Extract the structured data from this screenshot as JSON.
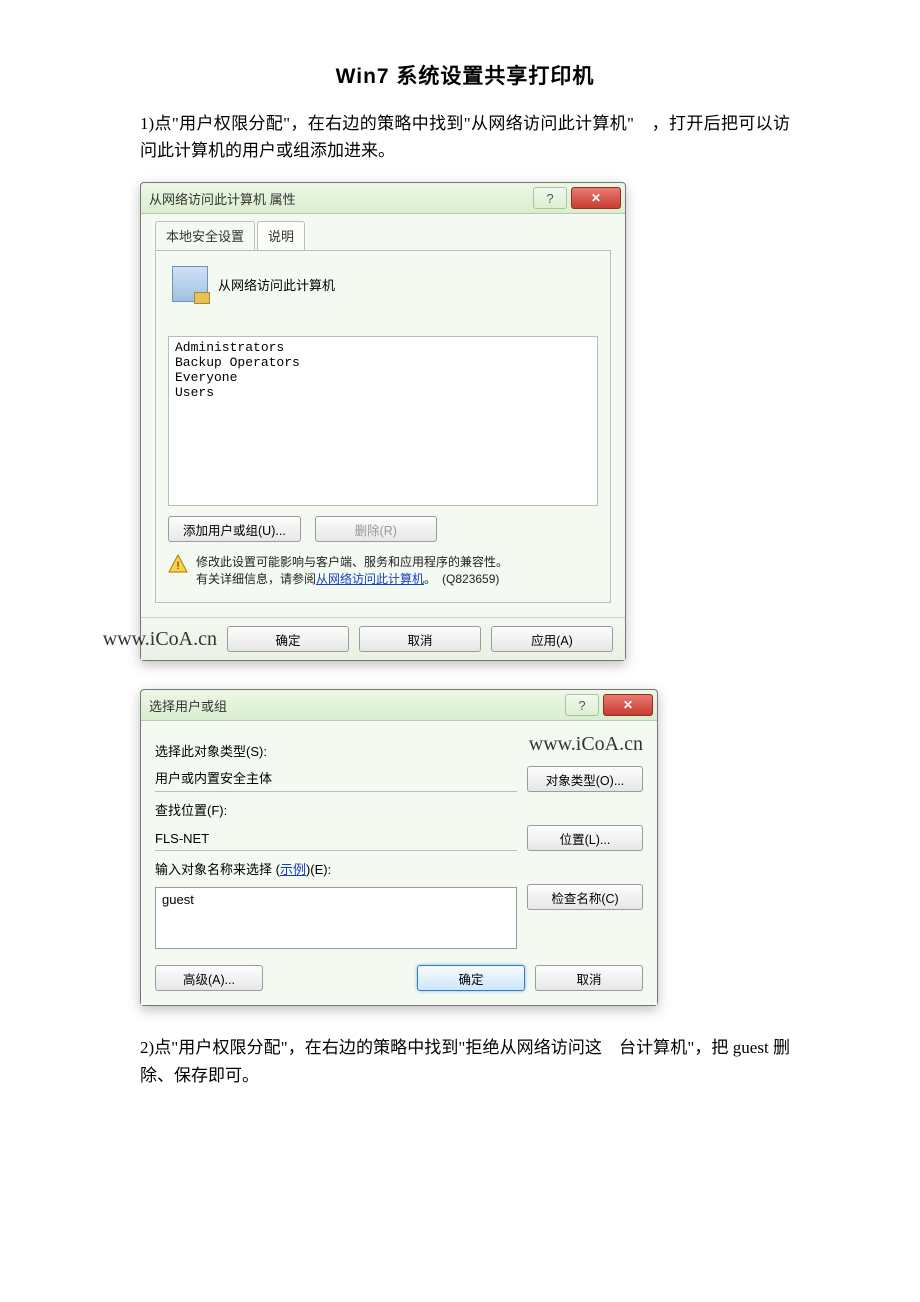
{
  "doc": {
    "title": "Win7 系统设置共享打印机",
    "para1": "1)点\"用户权限分配\"，在右边的策略中找到\"从网络访问此计算机\"　，打开后把可以访问此计算机的用户或组添加进来。",
    "para2": "2)点\"用户权限分配\"，在右边的策略中找到\"拒绝从网络访问这　台计算机\"，把 guest 删除、保存即可。"
  },
  "d1": {
    "title": "从网络访问此计算机 属性",
    "tab_active": "本地安全设置",
    "tab_inactive": "说明",
    "policy": "从网络访问此计算机",
    "users": [
      "Administrators",
      "Backup Operators",
      "Everyone",
      "Users"
    ],
    "add_btn": "添加用户或组(U)...",
    "remove_btn": "删除(R)",
    "warn_l1": "修改此设置可能影响与客户端、服务和应用程序的兼容性。",
    "warn_l2a": "有关详细信息，请参阅",
    "warn_link": "从网络访问此计算机",
    "warn_l2b": "。　(Q823659)",
    "watermark": "www.iCoA.cn",
    "ok": "确定",
    "cancel": "取消",
    "apply": "应用(A)"
  },
  "d2": {
    "title": "选择用户或组",
    "watermark": "www.iCoA.cn",
    "lbl_type": "选择此对象类型(S):",
    "val_type": "用户或内置安全主体",
    "btn_type": "对象类型(O)...",
    "lbl_loc": "查找位置(F):",
    "val_loc": "FLS-NET",
    "btn_loc": "位置(L)...",
    "lbl_input_a": "输入对象名称来选择 (",
    "lbl_input_link": "示例",
    "lbl_input_b": ")(E):",
    "input_value": "guest",
    "btn_check": "检查名称(C)",
    "btn_adv": "高级(A)...",
    "ok": "确定",
    "cancel": "取消"
  }
}
